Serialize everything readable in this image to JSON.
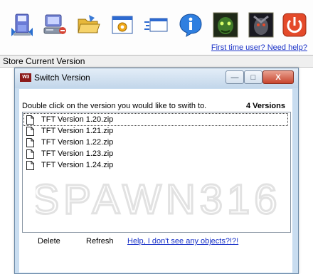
{
  "toolbar": {
    "buttons": [
      {
        "name": "store-version-icon"
      },
      {
        "name": "computer-icon"
      },
      {
        "name": "open-folder-icon"
      },
      {
        "name": "settings-window-icon"
      },
      {
        "name": "fast-window-icon"
      },
      {
        "name": "info-icon"
      },
      {
        "name": "undead-portrait-icon"
      },
      {
        "name": "orc-portrait-icon"
      },
      {
        "name": "power-icon"
      }
    ],
    "help_link": "First time user? Need help?",
    "status": "Store Current Version"
  },
  "window": {
    "title": "Switch Version",
    "app_icon_text": "W3",
    "controls": {
      "minimize": "—",
      "maximize": "□",
      "close": "X"
    },
    "instruction": "Double click on the version you would like to swith to.",
    "count_label": "4 Versions",
    "watermark": "SPAWN316",
    "versions": [
      "TFT Version 1.20.zip",
      "TFT Version 1.21.zip",
      "TFT Version 1.22.zip",
      "TFT Version 1.23.zip",
      "TFT Version 1.24.zip"
    ],
    "delete_label": "Delete",
    "refresh_label": "Refresh",
    "help_link": "Help, I don't see any objects?!?!"
  },
  "colors": {
    "link": "#1a32c8",
    "title_bar": "#c2d6ea",
    "close_button": "#c8452e"
  }
}
